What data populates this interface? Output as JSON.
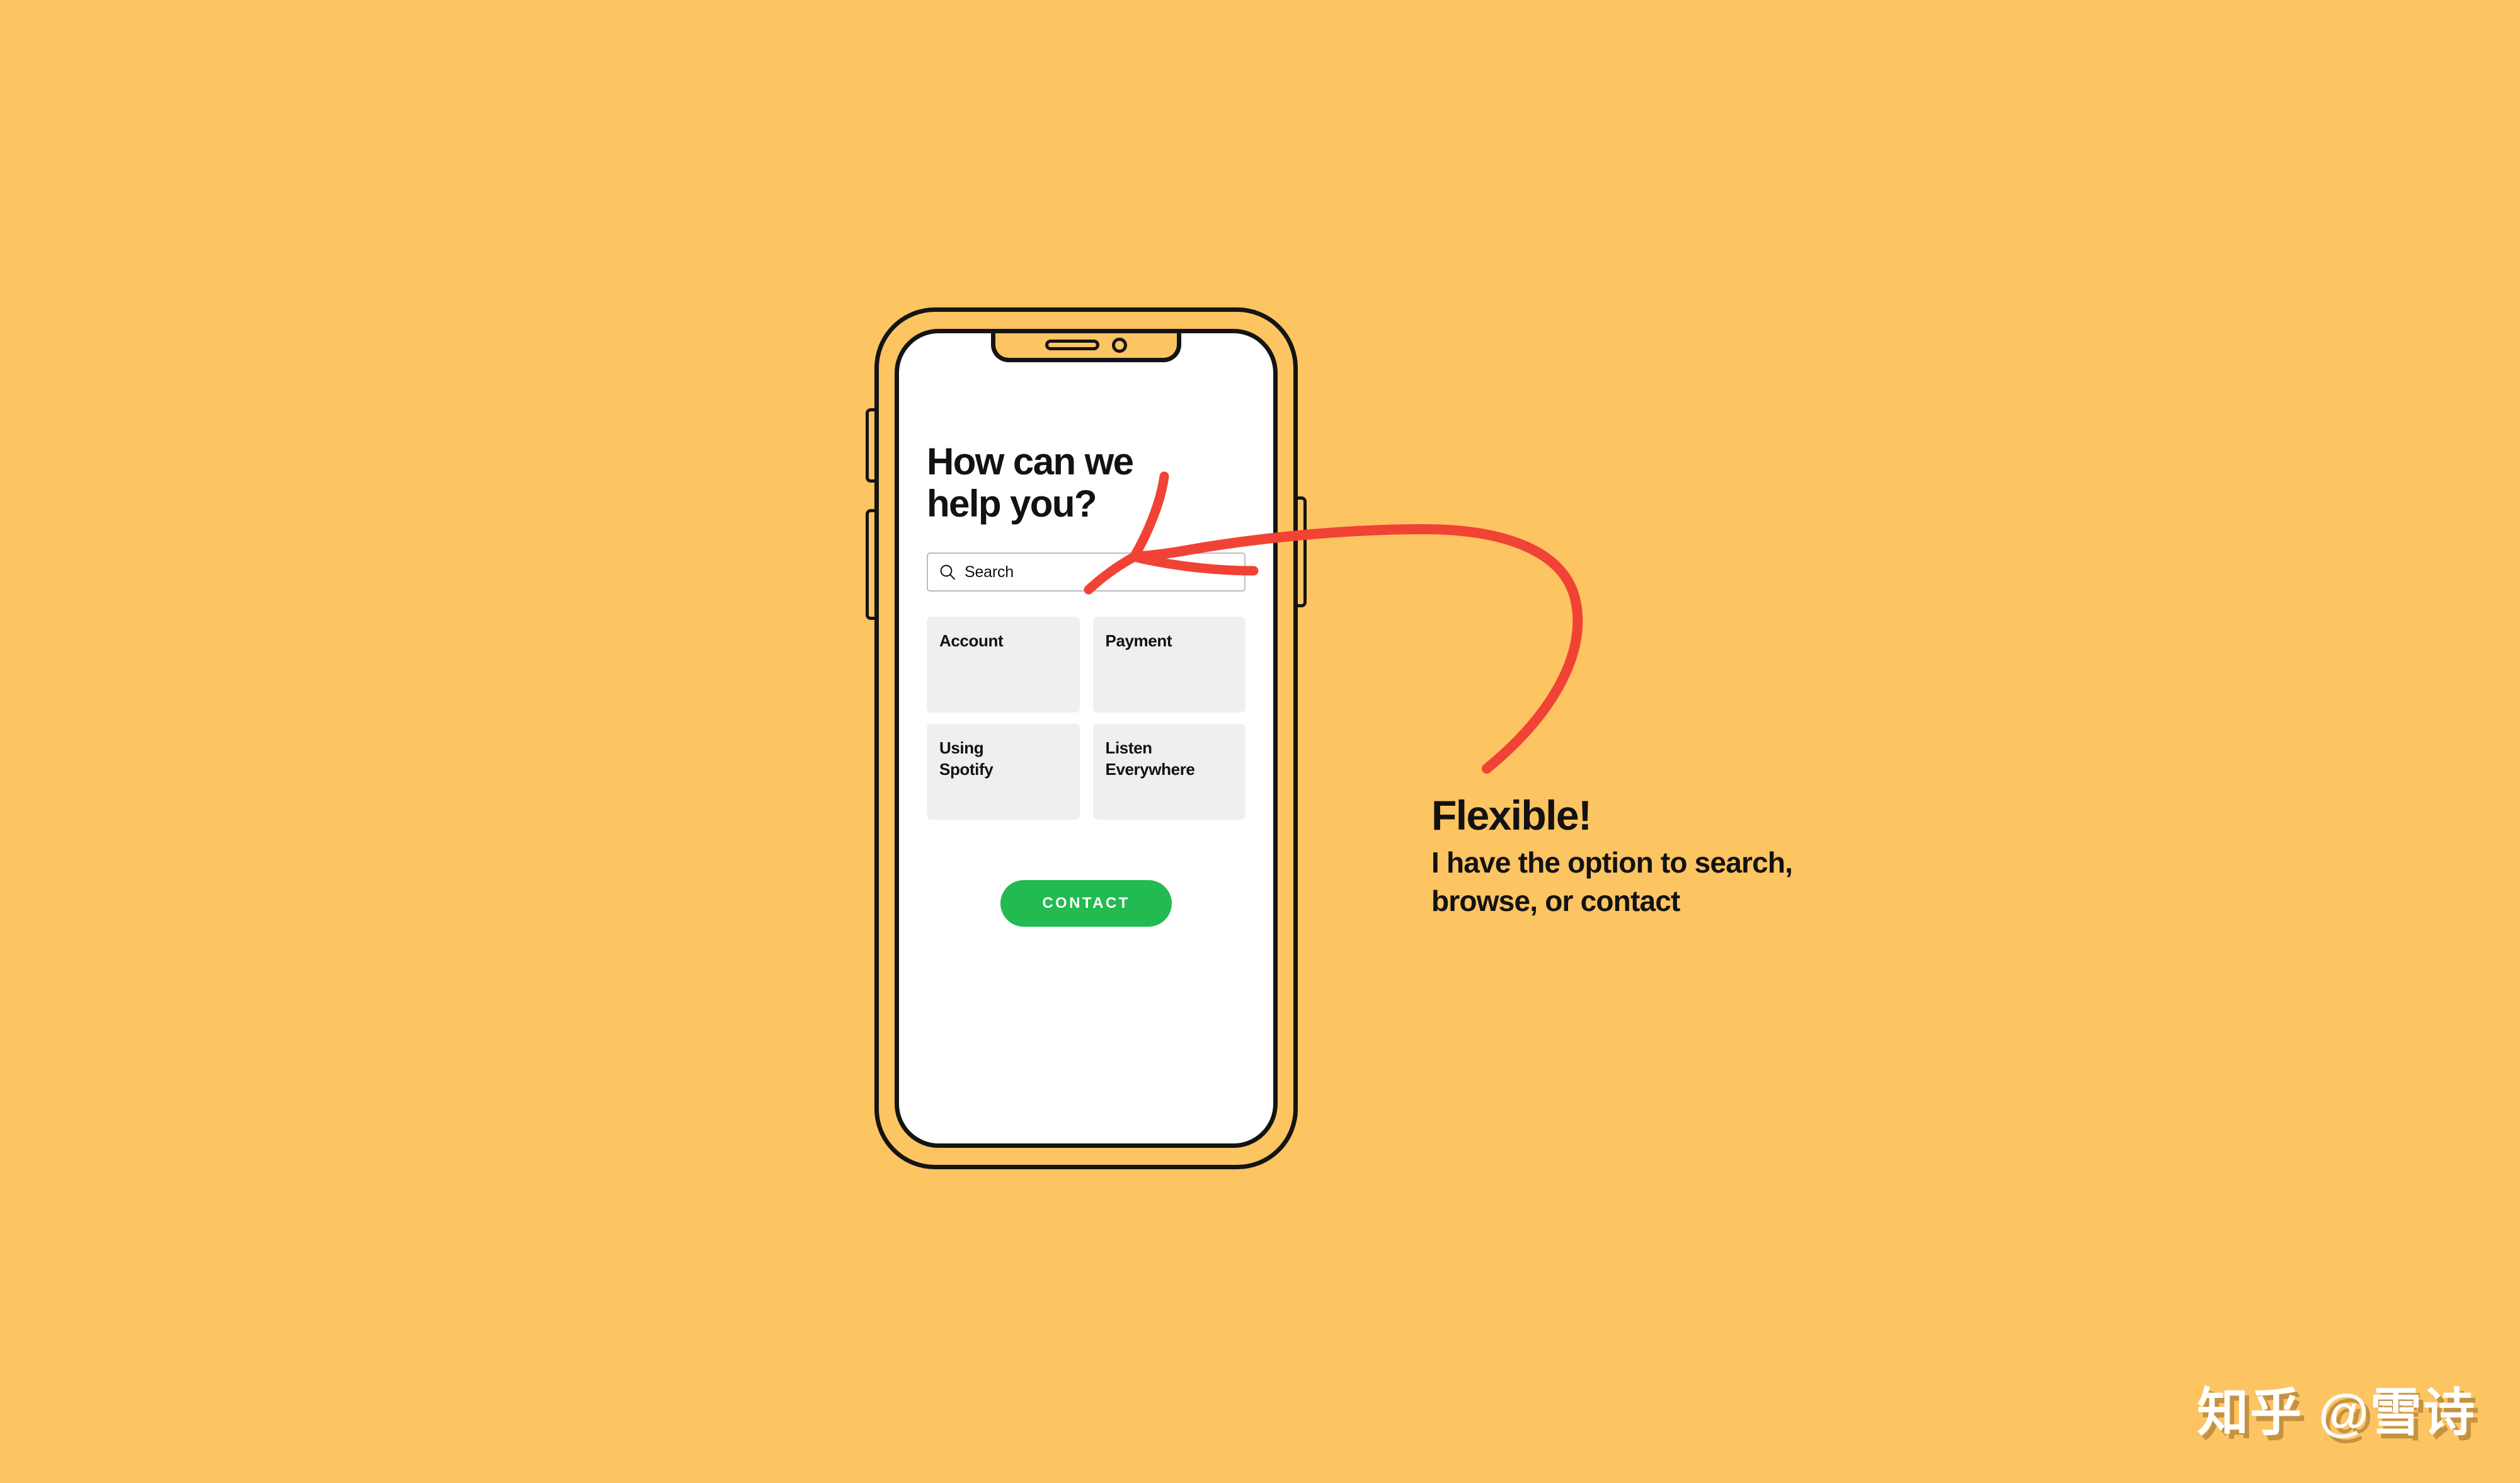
{
  "theme": {
    "background_color": "#FDC462",
    "outline_color": "#141414",
    "screen_color": "#FFFFFF",
    "card_color": "#EFEFEF",
    "accent_green": "#22BB51",
    "arrow_red": "#F04335",
    "text_color": "#121212"
  },
  "phone": {
    "notch": {
      "speaker_icon": "speaker-slot-icon",
      "camera_icon": "front-camera-icon"
    },
    "buttons": {
      "volume_up": "volume-up-button",
      "volume_down": "volume-down-button",
      "power": "power-button"
    }
  },
  "screen": {
    "heading": "How can we\nhelp you?",
    "search": {
      "icon": "search-icon",
      "placeholder": "Search",
      "value": ""
    },
    "categories": [
      {
        "label": "Account"
      },
      {
        "label": "Payment"
      },
      {
        "label": "Using\nSpotify"
      },
      {
        "label": "Listen\nEverywhere"
      }
    ],
    "contact_button_label": "CONTACT"
  },
  "annotation": {
    "arrow_icon": "curved-arrow-icon",
    "title": "Flexible!",
    "body": "I have the option to search,\nbrowse, or contact"
  },
  "watermark": {
    "text": "知乎 @雪诗"
  }
}
